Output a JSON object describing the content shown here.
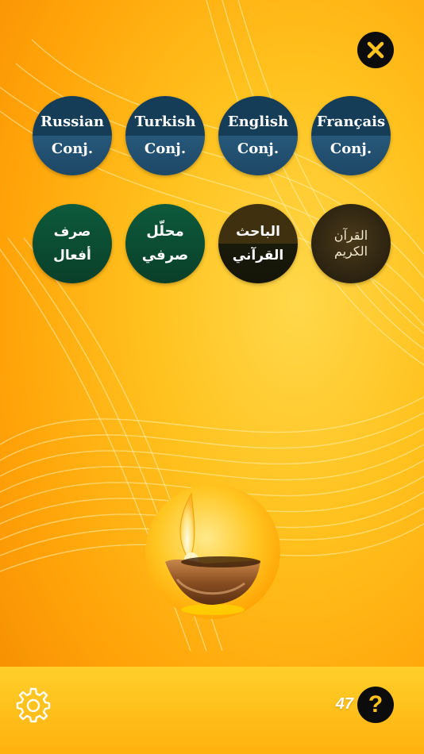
{
  "conj_buttons": [
    {
      "line1": "Russian",
      "line2": "Conj."
    },
    {
      "line1": "Turkish",
      "line2": "Conj."
    },
    {
      "line1": "English",
      "line2": "Conj."
    },
    {
      "line1": "Français",
      "line2": "Conj."
    }
  ],
  "arabic_buttons": [
    {
      "line1": "صرف",
      "line2": "أفعال"
    },
    {
      "line1": "محلّل صرفي"
    },
    {
      "line1": "الباحث",
      "line2": "القرآني"
    },
    {
      "line1": "القرآن الكريم"
    }
  ],
  "counter": "47",
  "help_label": "?",
  "icons": {
    "close": "close-icon",
    "settings": "gear-icon",
    "help": "question-icon",
    "lamp": "oil-lamp-icon"
  },
  "colors": {
    "accent": "#ffc21e",
    "dark": "#0c0c0c",
    "conj_blue": "#163d58",
    "arabic_green": "#0b4d33"
  }
}
